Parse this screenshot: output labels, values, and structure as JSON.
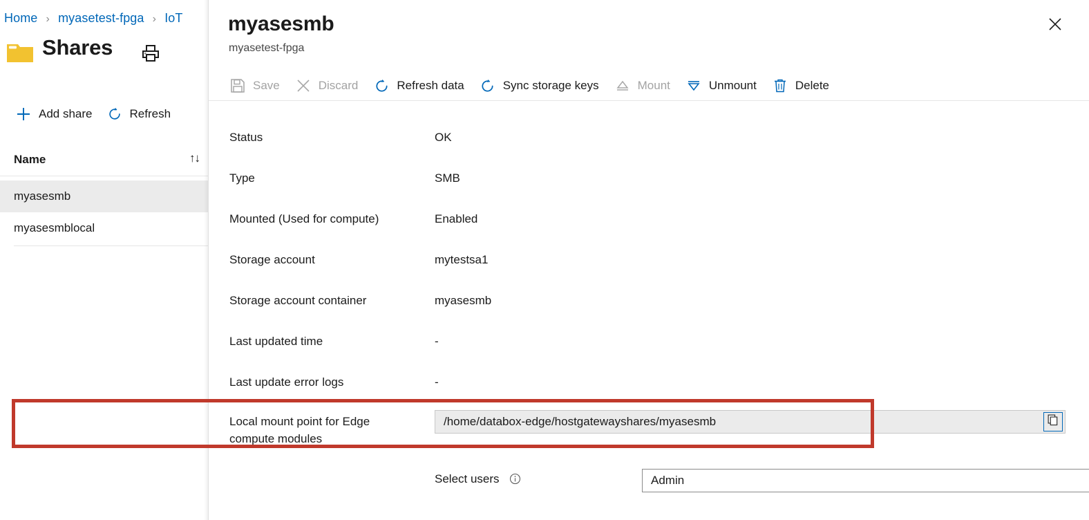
{
  "breadcrumb": {
    "items": [
      "Home",
      "myasetest-fpga",
      "IoT"
    ],
    "separator": "›"
  },
  "left_blade": {
    "page_title": "Shares",
    "folder_icon": "folder-icon",
    "print_icon": "print-icon",
    "commands": [
      {
        "label": "Add share",
        "icon": "plus-icon"
      },
      {
        "label": "Refresh",
        "icon": "refresh-icon"
      }
    ],
    "list": {
      "column_header": "Name",
      "sort_glyph": "↑↓",
      "rows": [
        {
          "name": "myasesmb",
          "selected": true
        },
        {
          "name": "myasesmblocal",
          "selected": false
        }
      ]
    }
  },
  "panel": {
    "title": "myasesmb",
    "subtitle": "myasetest-fpga",
    "close_icon": "close-icon",
    "commands": [
      {
        "label": "Save",
        "icon": "save-icon",
        "disabled": true
      },
      {
        "label": "Discard",
        "icon": "discard-icon",
        "disabled": true
      },
      {
        "label": "Refresh data",
        "icon": "refresh-icon",
        "disabled": false
      },
      {
        "label": "Sync storage keys",
        "icon": "sync-icon",
        "disabled": false
      },
      {
        "label": "Mount",
        "icon": "mount-icon",
        "disabled": true
      },
      {
        "label": "Unmount",
        "icon": "unmount-icon",
        "disabled": false
      },
      {
        "label": "Delete",
        "icon": "trash-icon",
        "disabled": false
      }
    ],
    "properties": [
      {
        "label": "Status",
        "value": "OK"
      },
      {
        "label": "Type",
        "value": "SMB"
      },
      {
        "label": "Mounted (Used for compute)",
        "value": "Enabled"
      },
      {
        "label": "Storage account",
        "value": "mytestsa1"
      },
      {
        "label": "Storage account container",
        "value": "myasesmb"
      },
      {
        "label": "Last updated time",
        "value": "-"
      },
      {
        "label": "Last update error logs",
        "value": "-"
      }
    ],
    "mount_point": {
      "label_line1": "Local mount point for Edge",
      "label_line2": "compute modules",
      "value": "/home/databox-edge/hostgatewayshares/myasesmb",
      "copy_icon": "copy-icon",
      "readonly": true
    },
    "select_users": {
      "label": "Select users",
      "info_icon": "info-icon",
      "value": "Admin",
      "chevron_icon": "chevron-down-icon",
      "options": [
        "Admin"
      ]
    }
  },
  "colors": {
    "accent": "#0067b8",
    "link": "#0067b8",
    "highlight_box": "#c0392b",
    "selected_row": "#ebebeb",
    "folder": "#f2c230",
    "disabled_text": "#a3a3a3"
  }
}
